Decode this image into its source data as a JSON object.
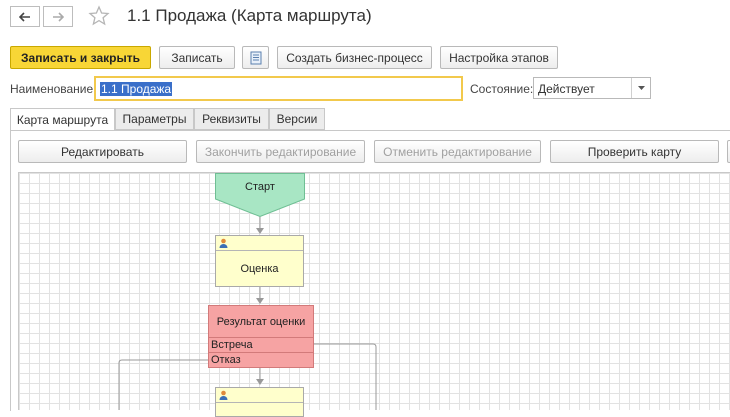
{
  "window": {
    "title": "1.1 Продажа (Карта маршрута)"
  },
  "nav": {
    "back_icon": "arrow-left-icon",
    "forward_icon": "arrow-right-icon",
    "favorite_icon": "star-icon"
  },
  "toolbar": {
    "save_close": "Записать и закрыть",
    "save": "Записать",
    "create_bp": "Создать бизнес-процесс",
    "stages_setup": "Настройка этапов"
  },
  "form": {
    "name_label": "Наименование:",
    "name_value": "1.1 Продажа",
    "state_label": "Состояние:",
    "state_value": "Действует"
  },
  "tabs": [
    {
      "label": "Карта маршрута",
      "active": true
    },
    {
      "label": "Параметры"
    },
    {
      "label": "Реквизиты"
    },
    {
      "label": "Версии"
    }
  ],
  "map_toolbar": {
    "edit": "Редактировать",
    "finish_edit": "Закончить редактирование",
    "cancel_edit": "Отменить редактирование",
    "check_map": "Проверить карту"
  },
  "diagram": {
    "start": "Старт",
    "assessment": "Оценка",
    "result": "Результат оценки",
    "option_meeting": "Встреча",
    "option_refusal": "Отказ",
    "colors": {
      "start": "#a8e6c4",
      "task": "#ffffcc",
      "decision": "#f6a3a3"
    }
  }
}
